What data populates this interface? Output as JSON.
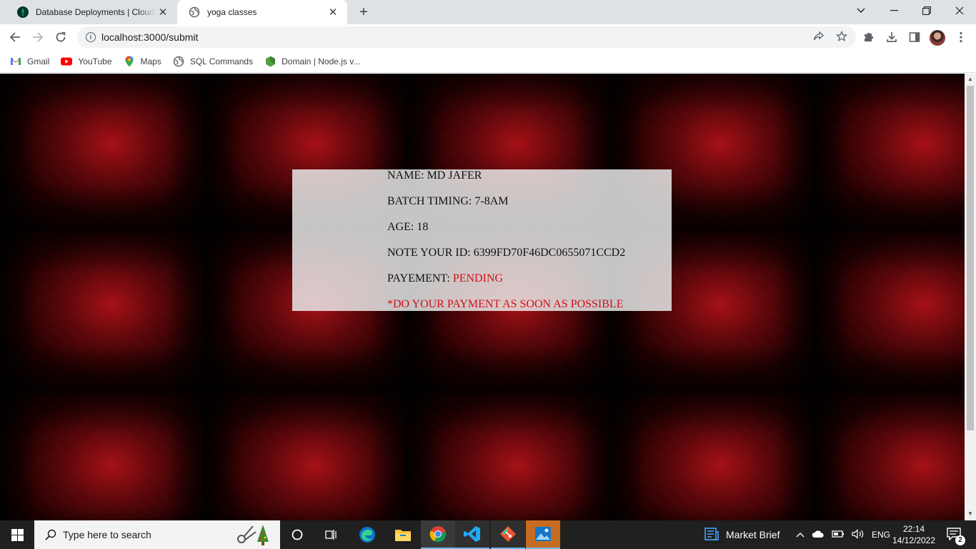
{
  "browser": {
    "tabs": [
      {
        "title": "Database Deployments | Cloud: MongoDB",
        "active": false
      },
      {
        "title": "yoga classes",
        "active": true
      }
    ],
    "url": "localhost:3000/submit",
    "bookmarks": [
      {
        "label": "Gmail",
        "icon": "gmail-icon"
      },
      {
        "label": "YouTube",
        "icon": "youtube-icon"
      },
      {
        "label": "Maps",
        "icon": "maps-icon"
      },
      {
        "label": "SQL Commands",
        "icon": "globe-icon"
      },
      {
        "label": "Domain | Node.js v...",
        "icon": "nodejs-icon"
      }
    ]
  },
  "submission": {
    "name_label": "NAME:",
    "name_value": "MD JAFER",
    "batch_label": "BATCH TIMING:",
    "batch_value": "7-8AM",
    "age_label": "AGE:",
    "age_value": "18",
    "id_label": "NOTE YOUR ID:",
    "id_value": "6399FD70F46DC0655071CCD2",
    "payment_label": "PAYEMENT:",
    "payment_status": "PENDING",
    "payment_notice": "*DO YOUR PAYMENT AS SOON AS POSSIBLE"
  },
  "colors": {
    "accent_red": "#d0101a",
    "card_bg": "#ebebeb"
  },
  "taskbar": {
    "search_placeholder": "Type here to search",
    "widget_label": "Market Brief",
    "language": "ENG",
    "time": "22:14",
    "date": "14/12/2022",
    "notification_count": "2"
  }
}
